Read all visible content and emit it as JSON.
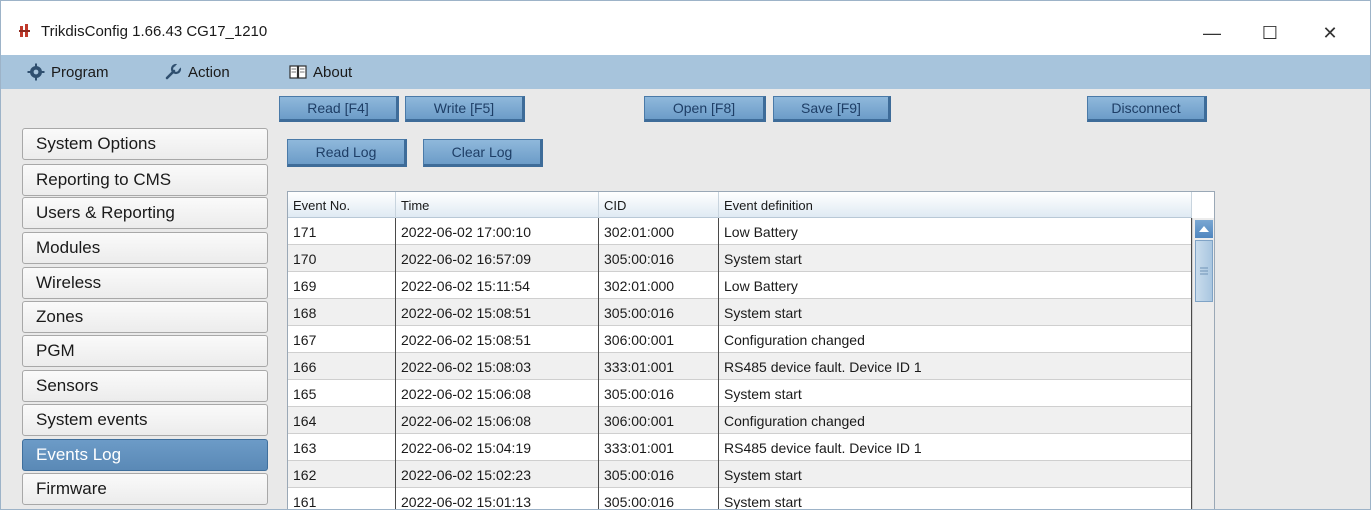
{
  "window": {
    "title": "TrikdisConfig 1.66.43    CG17_1210",
    "controls": {
      "minimize": "—",
      "maximize": "☐",
      "close": "✕"
    }
  },
  "menu": [
    {
      "label": "Program",
      "icon": "gear-icon"
    },
    {
      "label": "Action",
      "icon": "wrench-icon"
    },
    {
      "label": "About",
      "icon": "book-icon"
    }
  ],
  "toolbar": {
    "read": "Read [F4]",
    "write": "Write [F5]",
    "open": "Open [F8]",
    "save": "Save [F9]",
    "disconnect": "Disconnect"
  },
  "log_actions": {
    "read_log": "Read Log",
    "clear_log": "Clear Log"
  },
  "sidebar": {
    "items": [
      {
        "label": "System Options"
      },
      {
        "label": "Reporting to CMS"
      },
      {
        "label": "Users & Reporting"
      },
      {
        "label": "Modules"
      },
      {
        "label": "Wireless"
      },
      {
        "label": "Zones"
      },
      {
        "label": "PGM"
      },
      {
        "label": "Sensors"
      },
      {
        "label": "System events"
      },
      {
        "label": "Events Log"
      },
      {
        "label": "Firmware"
      }
    ],
    "active": "Events Log"
  },
  "table": {
    "columns": [
      "Event No.",
      "Time",
      "CID",
      "Event definition"
    ],
    "rows": [
      [
        "171",
        "2022-06-02 17:00:10",
        "302:01:000",
        "Low Battery"
      ],
      [
        "170",
        "2022-06-02 16:57:09",
        "305:00:016",
        "System start"
      ],
      [
        "169",
        "2022-06-02 15:11:54",
        "302:01:000",
        "Low Battery"
      ],
      [
        "168",
        "2022-06-02 15:08:51",
        "305:00:016",
        "System start"
      ],
      [
        "167",
        "2022-06-02 15:08:51",
        "306:00:001",
        "Configuration changed"
      ],
      [
        "166",
        "2022-06-02 15:08:03",
        "333:01:001",
        "RS485 device fault. Device ID 1"
      ],
      [
        "165",
        "2022-06-02 15:06:08",
        "305:00:016",
        "System start"
      ],
      [
        "164",
        "2022-06-02 15:06:08",
        "306:00:001",
        "Configuration changed"
      ],
      [
        "163",
        "2022-06-02 15:04:19",
        "333:01:001",
        "RS485 device fault. Device ID 1"
      ],
      [
        "162",
        "2022-06-02 15:02:23",
        "305:00:016",
        "System start"
      ],
      [
        "161",
        "2022-06-02 15:01:13",
        "305:00:016",
        "System start"
      ]
    ]
  },
  "colors": {
    "menubar": "#a7c4dc",
    "button": "#7aa8d2",
    "active_sidebar": "#6391be"
  }
}
